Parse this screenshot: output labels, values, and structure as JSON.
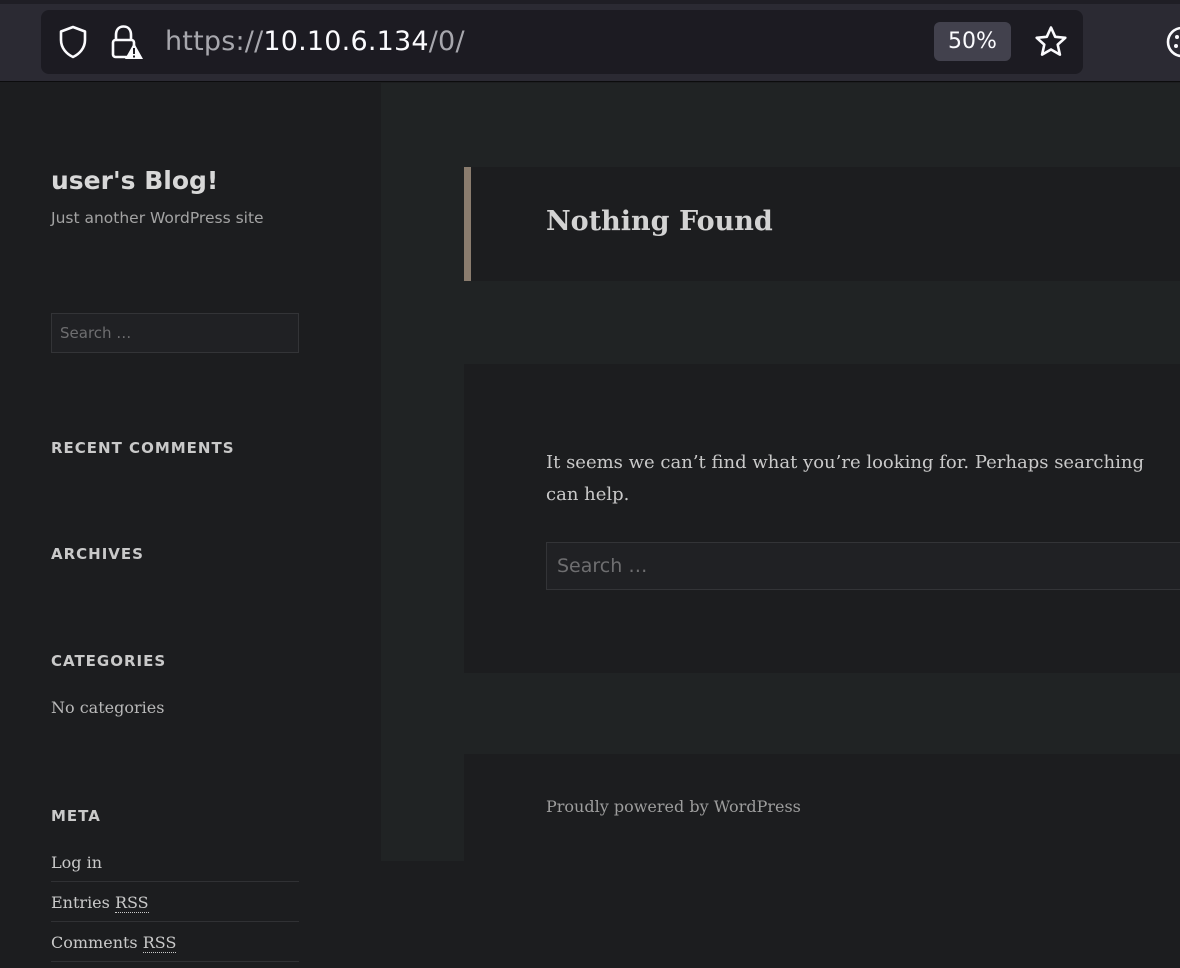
{
  "browser": {
    "url_scheme": "https://",
    "url_host": "10.10.6.134",
    "url_path": "/0/",
    "zoom": "50%",
    "icons": [
      "shield-icon",
      "lock-warning-icon",
      "star-icon",
      "extension-icon"
    ]
  },
  "site": {
    "title": "user's Blog!",
    "description": "Just another WordPress site"
  },
  "sidebar": {
    "search_placeholder": "Search …",
    "recent_comments_title": "RECENT COMMENTS",
    "archives_title": "ARCHIVES",
    "categories_title": "CATEGORIES",
    "categories_empty": "No categories",
    "meta_title": "META",
    "meta_links": {
      "login": "Log in",
      "entries_prefix": "Entries ",
      "comments_prefix": "Comments ",
      "rss": "RSS"
    }
  },
  "main": {
    "page_title": "Nothing Found",
    "message": "It seems we can’t find what you’re looking for. Perhaps searching can help.",
    "search_placeholder": "Search …",
    "footer": "Proudly powered by WordPress"
  },
  "colors": {
    "page_bg": "#1c1d1f",
    "main_bg": "#202324",
    "header_accent": "#8a7c6e",
    "toolbar_bg": "#2b2a33",
    "urlbar_bg": "#1c1b22"
  }
}
